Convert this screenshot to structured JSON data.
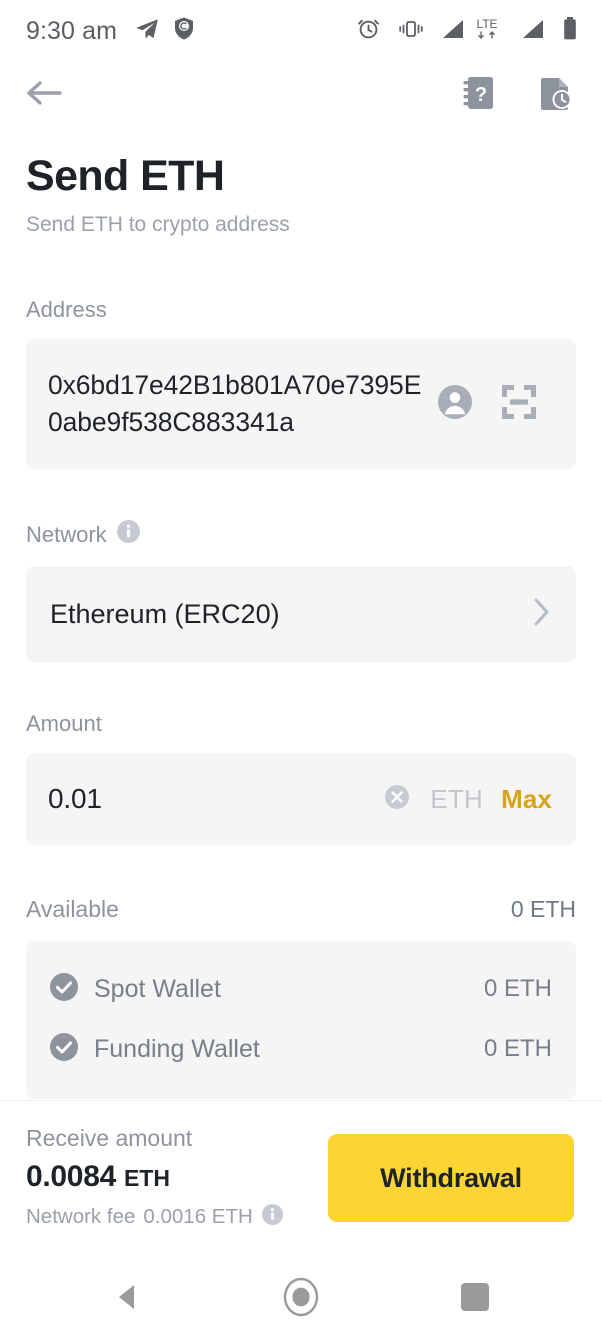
{
  "status_bar": {
    "time": "9:30 am",
    "left_icons": [
      "telegram-icon",
      "shield-c-icon"
    ],
    "right_icons": [
      "alarm-icon",
      "vibrate-icon",
      "signal-icon",
      "lte-icon",
      "signal-2-icon",
      "battery-icon"
    ],
    "network_type": "LTE"
  },
  "app_bar": {
    "back_icon": "back-arrow-icon",
    "help_icon": "help-book-icon",
    "history_icon": "transaction-history-icon"
  },
  "header": {
    "title": "Send ETH",
    "subtitle": "Send ETH to crypto address"
  },
  "address": {
    "label": "Address",
    "value": "0x6bd17e42B1b801A70e7395E0abe9f538C883341a",
    "contacts_icon": "contact-person-icon",
    "scan_icon": "qr-scan-icon"
  },
  "network": {
    "label": "Network",
    "info_icon": "info-icon",
    "value": "Ethereum (ERC20)",
    "chevron_icon": "chevron-right-icon"
  },
  "amount": {
    "label": "Amount",
    "value": "0.01",
    "placeholder": "0.01",
    "clear_icon": "clear-circle-icon",
    "unit": "ETH",
    "max_label": "Max"
  },
  "available": {
    "label": "Available",
    "total": "0 ETH",
    "wallets": [
      {
        "name": "Spot Wallet",
        "amount": "0 ETH",
        "checked": true
      },
      {
        "name": "Funding Wallet",
        "amount": "0 ETH",
        "checked": true
      }
    ]
  },
  "bottom_bar": {
    "receive_label": "Receive amount",
    "receive_value": "0.0084",
    "receive_unit": "ETH",
    "fee_label": "Network fee",
    "fee_value": "0.0016 ETH",
    "fee_info_icon": "info-icon",
    "submit_label": "Withdrawal"
  },
  "nav_bar": {
    "back": "nav-back-icon",
    "home": "nav-home-icon",
    "recents": "nav-recents-icon"
  },
  "colors": {
    "accent_yellow": "#fcd535",
    "max_gold": "#d8a518",
    "text_primary": "#1e2329",
    "text_muted": "#8d949e",
    "field_bg": "#f5f5f5"
  }
}
